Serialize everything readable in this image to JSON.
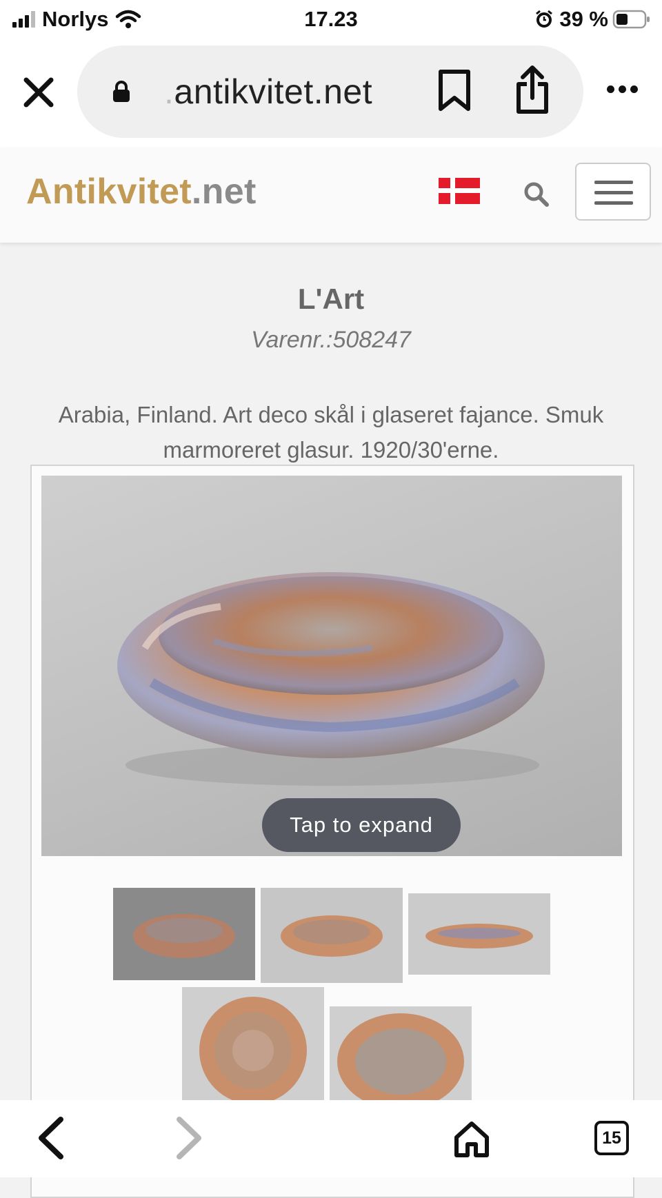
{
  "status_bar": {
    "carrier": "Norlys",
    "time": "17.23",
    "battery": "39 %"
  },
  "browser": {
    "url_faded": ".",
    "url_main": "antikvitet.net"
  },
  "site": {
    "logo_part1": "Antikvitet",
    "logo_part2": ".net"
  },
  "product": {
    "title": "L'Art",
    "item_number": "Varenr.:508247",
    "description": "Arabia, Finland. Art deco skål i glaseret fajance. Smuk marmoreret glasur. 1920/30'erne.",
    "expand_label": "Tap to expand"
  },
  "toolbar": {
    "tab_count": "15"
  },
  "colors": {
    "logo_gold": "#c19a55",
    "logo_gray": "#8a8a8a",
    "flag_red": "#e31b2b",
    "pill_bg": "#efefef"
  },
  "icons": [
    "signal-icon",
    "wifi-icon",
    "alarm-icon",
    "battery-icon",
    "close-icon",
    "lock-icon",
    "bookmark-icon",
    "share-icon",
    "more-icon",
    "danish-flag-icon",
    "search-icon",
    "menu-icon",
    "back-icon",
    "forward-icon",
    "home-icon",
    "tabs-icon"
  ]
}
